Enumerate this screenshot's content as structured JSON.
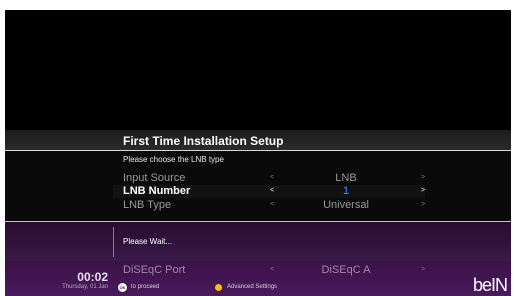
{
  "header": {
    "title": "First Time Installation Setup"
  },
  "prompt": "Please choose the LNB type",
  "settings": [
    {
      "label": "Input Source",
      "value": "LNB"
    },
    {
      "label": "LNB Number",
      "value": "1"
    },
    {
      "label": "LNB Type",
      "value": "Universal"
    }
  ],
  "wait_message": "Please Wait...",
  "diseqc": {
    "label": "DiSEqC Port",
    "value": "DiSEqC A"
  },
  "footer": {
    "time": "00:02",
    "date": "Thursday, 01 Jan",
    "ok_icon": "OK",
    "ok_hint": "to proceed",
    "yellow_hint": "Advanced Settings",
    "logo": "beIN"
  },
  "colors": {
    "accent_blue": "#4d8cff",
    "purple": "#3a1148",
    "yellow_key": "#f5c400"
  },
  "icons": {
    "ok_button": "ok-button-icon",
    "yellow_button": "yellow-dot-icon",
    "arrow_left": "chevron-left-icon",
    "arrow_right": "chevron-right-icon"
  }
}
